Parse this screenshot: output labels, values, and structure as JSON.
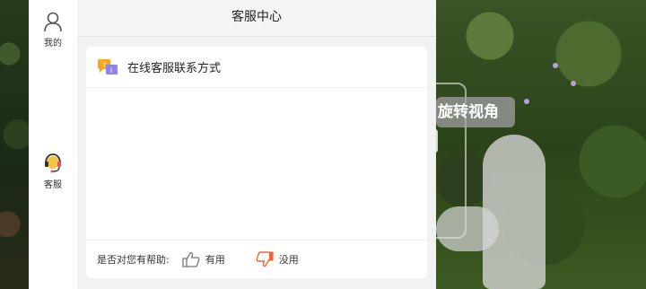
{
  "sidebar": {
    "items": [
      {
        "label": "我的",
        "icon": "user-icon"
      },
      {
        "label": "客服",
        "icon": "headset-icon"
      }
    ]
  },
  "panel": {
    "title": "客服中心",
    "card": {
      "heading": "在线客服联系方式",
      "icon": "chat-bubbles-icon",
      "feedback": {
        "question": "是否对您有帮助:",
        "yes_label": "有用",
        "no_label": "没用"
      }
    }
  },
  "game": {
    "hint_text": "旋转视角"
  },
  "colors": {
    "thumbs_up": "#777777",
    "thumbs_down": "#e8663a",
    "headset_accent": "#e84a5f",
    "chat_yellow": "#f5a623",
    "chat_purple": "#8f86e3"
  }
}
